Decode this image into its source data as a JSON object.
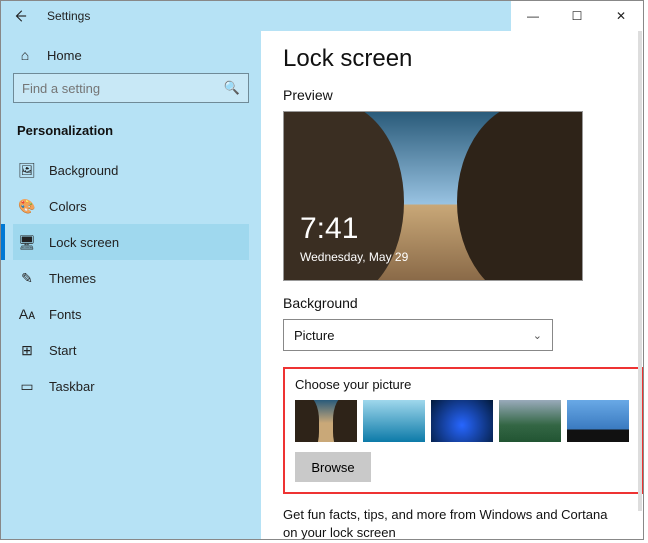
{
  "app_title": "Settings",
  "window_controls": {
    "min": "—",
    "max": "☐",
    "close": "✕"
  },
  "home_label": "Home",
  "search_placeholder": "Find a setting",
  "section_label": "Personalization",
  "nav": [
    {
      "icon": "🖼",
      "label": "Background"
    },
    {
      "icon": "🎨",
      "label": "Colors"
    },
    {
      "icon": "🖥",
      "label": "Lock screen",
      "selected": true
    },
    {
      "icon": "✎",
      "label": "Themes"
    },
    {
      "icon": "Aᴀ",
      "label": "Fonts"
    },
    {
      "icon": "⊞",
      "label": "Start"
    },
    {
      "icon": "▭",
      "label": "Taskbar"
    }
  ],
  "page_title": "Lock screen",
  "preview_label": "Preview",
  "preview": {
    "time": "7:41",
    "date": "Wednesday, May 29"
  },
  "background_label": "Background",
  "background_value": "Picture",
  "choose_label": "Choose your picture",
  "browse_label": "Browse",
  "footer_text": "Get fun facts, tips, and more from Windows and Cortana on your lock screen"
}
